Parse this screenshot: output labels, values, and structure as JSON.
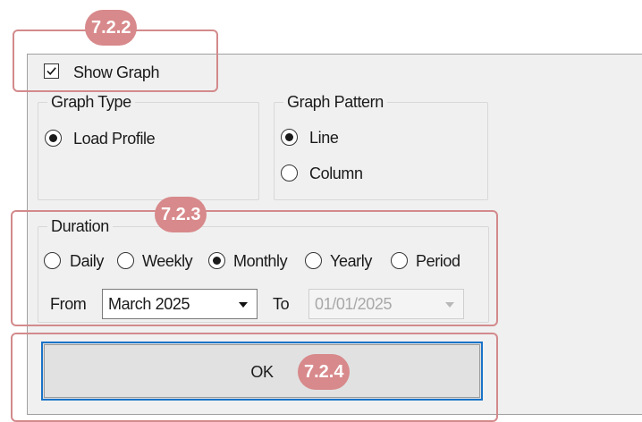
{
  "show_graph": {
    "label": "Show Graph",
    "checked": true
  },
  "graph_type": {
    "title": "Graph Type",
    "options": [
      {
        "label": "Load Profile",
        "selected": true
      }
    ]
  },
  "graph_pattern": {
    "title": "Graph Pattern",
    "options": [
      {
        "label": "Line",
        "selected": true
      },
      {
        "label": "Column",
        "selected": false
      }
    ]
  },
  "duration": {
    "title": "Duration",
    "options": [
      {
        "label": "Daily",
        "selected": false
      },
      {
        "label": "Weekly",
        "selected": false
      },
      {
        "label": "Monthly",
        "selected": true
      },
      {
        "label": "Yearly",
        "selected": false
      },
      {
        "label": "Period",
        "selected": false
      }
    ],
    "from_label": "From",
    "from_value": "March 2025",
    "to_label": "To",
    "to_value": "01/01/2025",
    "to_enabled": false
  },
  "ok_button": {
    "label": "OK"
  },
  "callouts": [
    "7.2.2",
    "7.2.3",
    "7.2.4"
  ],
  "colors": {
    "panel_bg": "#f0f0f0",
    "callout": "#d8898b",
    "focus_border": "#1a73c8"
  }
}
